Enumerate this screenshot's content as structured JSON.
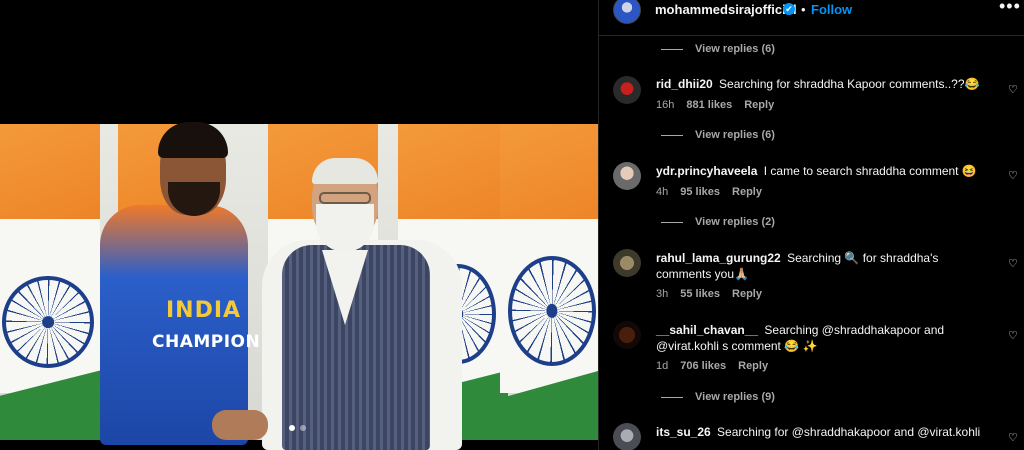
{
  "post": {
    "username": "mohammedsirajofficial",
    "verified_mark": "✔",
    "separator": "•",
    "follow_label": "Follow",
    "more_label": "•••",
    "media": {
      "jersey_text_line1": "INDIA",
      "jersey_text_line2": "CHAMPION",
      "carousel_total": 2,
      "carousel_active": 1
    }
  },
  "comments_top_view_replies": "View replies (6)",
  "comments": [
    {
      "username": "rid_dhii20",
      "text": "Searching for shraddha Kapoor comments..??😂",
      "time": "16h",
      "likes": "881 likes",
      "reply_label": "Reply",
      "view_replies": "View replies (6)"
    },
    {
      "username": "ydr.princyhaveela",
      "text": "I came to search shraddha comment 😆",
      "time": "4h",
      "likes": "95 likes",
      "reply_label": "Reply",
      "view_replies": "View replies (2)"
    },
    {
      "username": "rahul_lama_gurung22",
      "text": "Searching 🔍 for shraddha's comments you🙏🏼",
      "time": "3h",
      "likes": "55 likes",
      "reply_label": "Reply",
      "view_replies": ""
    },
    {
      "username": "__sahil_chavan__",
      "text": "Searching @shraddhakapoor and @virat.kohli s comment 😂 ✨",
      "time": "1d",
      "likes": "706 likes",
      "reply_label": "Reply",
      "view_replies": "View replies (9)"
    },
    {
      "username": "its_su_26",
      "text": "Searching for @shraddhakapoor and @virat.kohli",
      "time": "",
      "likes": "",
      "reply_label": "",
      "view_replies": ""
    }
  ],
  "icons": {
    "heart": "♡",
    "more": "more-horizontal-icon",
    "verified": "verified-badge-icon"
  },
  "colors": {
    "background": "#000000",
    "link_blue": "#0095f6",
    "secondary_text": "#a8a8a8",
    "divider": "#262626"
  }
}
